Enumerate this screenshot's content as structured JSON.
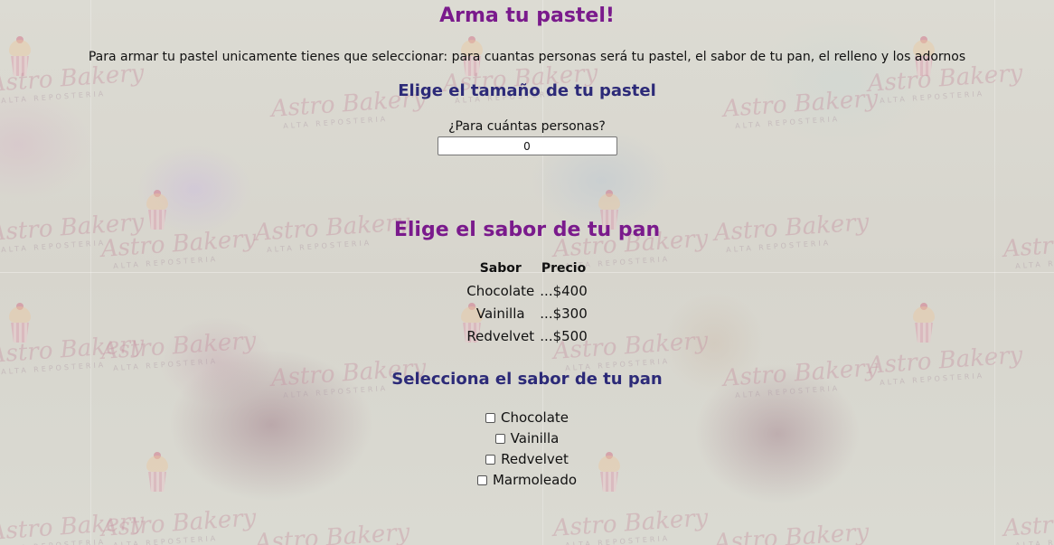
{
  "page": {
    "title": "Arma tu pastel!",
    "intro": "Para armar tu pastel unicamente tienes que seleccionar: para cuantas personas será tu pastel, el sabor de tu pan, el relleno y los adornos"
  },
  "size_section": {
    "title": "Elige el tamaño de tu pastel",
    "people_label": "¿Para cuántas personas?",
    "people_value": "0"
  },
  "flavor_section": {
    "title": "Elige el sabor de tu pan",
    "table": {
      "headers": [
        "Sabor",
        "Precio"
      ],
      "rows": [
        [
          "Chocolate",
          "...$400"
        ],
        [
          "Vainilla",
          "...$300"
        ],
        [
          "Redvelvet",
          "...$500"
        ]
      ]
    },
    "select_title": "Selecciona el sabor de tu pan",
    "options": [
      {
        "label": "Chocolate",
        "checked": false
      },
      {
        "label": "Vainilla",
        "checked": false
      },
      {
        "label": "Redvelvet",
        "checked": false
      },
      {
        "label": "Marmoleado",
        "checked": false
      }
    ]
  },
  "background": {
    "watermark": "Astro Bakery",
    "watermark_sub": "ALTA REPOSTERIA"
  },
  "colors": {
    "title": "#7a1a8c",
    "subtitle": "#2c2a78",
    "background": "#d9d8cf"
  }
}
